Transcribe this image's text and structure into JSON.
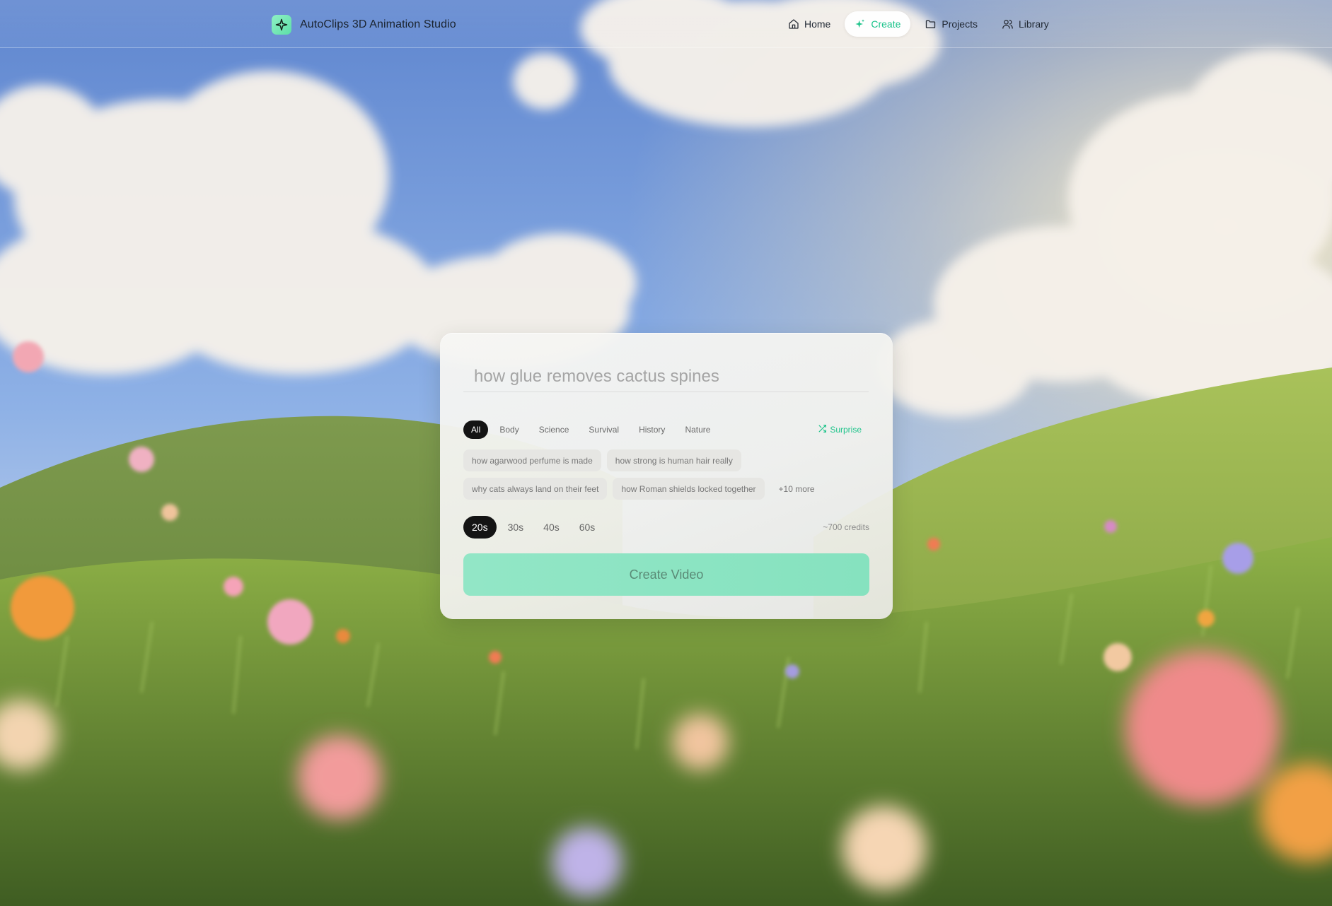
{
  "app": {
    "title": "AutoClips 3D Animation Studio",
    "logo_icon": "sparkle-icon",
    "accent_color": "#1fc48b"
  },
  "nav": {
    "items": [
      {
        "label": "Home",
        "icon": "home-icon"
      },
      {
        "label": "Create",
        "icon": "sparkle-icon",
        "active": true
      },
      {
        "label": "Projects",
        "icon": "folder-icon"
      },
      {
        "label": "Library",
        "icon": "users-icon"
      }
    ]
  },
  "create_panel": {
    "prompt_placeholder": "how glue removes cactus spines",
    "prompt_value": "",
    "categories": [
      "All",
      "Body",
      "Science",
      "Survival",
      "History",
      "Nature"
    ],
    "active_category": "All",
    "surprise_label": "Surprise",
    "surprise_icon": "shuffle-icon",
    "suggestions": [
      [
        "how agarwood perfume is made",
        "how strong is human hair really"
      ],
      [
        "why cats always land on their feet",
        "how Roman shields locked together"
      ]
    ],
    "more_label": "+10 more",
    "durations": [
      "20s",
      "30s",
      "40s",
      "60s"
    ],
    "active_duration": "20s",
    "credits_label": "~700 credits",
    "create_button_label": "Create Video"
  }
}
